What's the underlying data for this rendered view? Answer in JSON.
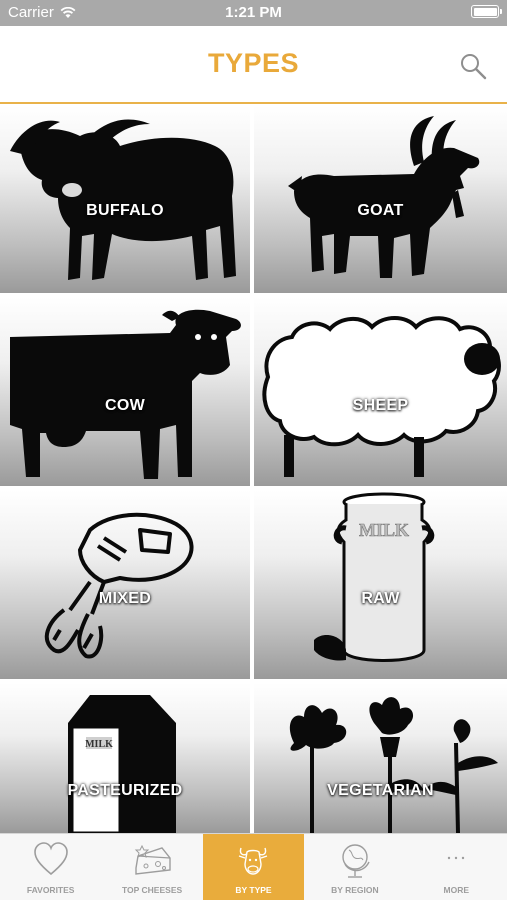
{
  "status_bar": {
    "carrier": "Carrier",
    "time": "1:21 PM"
  },
  "nav": {
    "title": "TYPES"
  },
  "types": [
    {
      "label": "BUFFALO",
      "icon": "buffalo-icon"
    },
    {
      "label": "GOAT",
      "icon": "goat-icon"
    },
    {
      "label": "COW",
      "icon": "cow-icon"
    },
    {
      "label": "SHEEP",
      "icon": "sheep-icon"
    },
    {
      "label": "MIXED",
      "icon": "hand-mixer-icon"
    },
    {
      "label": "RAW",
      "icon": "milk-can-icon"
    },
    {
      "label": "PASTEURIZED",
      "icon": "milk-carton-icon"
    },
    {
      "label": "VEGETARIAN",
      "icon": "thistle-flowers-icon"
    }
  ],
  "milk_can_text": "MILK",
  "milk_carton_text": "MILK",
  "tabs": [
    {
      "label": "FAVORITES",
      "icon": "heart-icon",
      "active": false
    },
    {
      "label": "TOP CHEESES",
      "icon": "cheese-icon",
      "active": false
    },
    {
      "label": "BY TYPE",
      "icon": "cow-head-icon",
      "active": true
    },
    {
      "label": "BY REGION",
      "icon": "globe-icon",
      "active": false
    },
    {
      "label": "MORE",
      "icon": "more-dots-icon",
      "active": false
    }
  ],
  "colors": {
    "accent": "#e9ac3c",
    "status_bar": "#a9a9a9",
    "tab_inactive": "#9d9d9d"
  }
}
